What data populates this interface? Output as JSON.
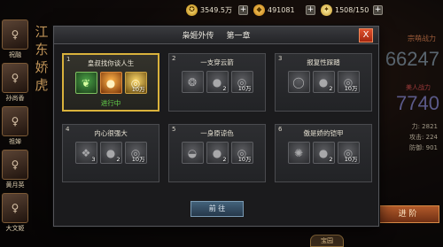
{
  "topbar": {
    "gold": "3549.5万",
    "ingot": "491081",
    "stamina": "1508/150"
  },
  "characters": [
    {
      "name": "祝融"
    },
    {
      "name": "孙尚香"
    },
    {
      "name": "祖婵"
    },
    {
      "name": "黄月英"
    },
    {
      "name": "大文姬"
    }
  ],
  "vertical_title": "江东娇虎",
  "right_panel": {
    "label1": "宗萌战力",
    "power": "66247",
    "label2": "美人战力",
    "power2": "7740",
    "stat_a": "力: 2821",
    "stat_b": "攻击: 224",
    "stat_c": "防御: 901",
    "advance_button": "进 阶",
    "bottom_badge": "宝园"
  },
  "dialog": {
    "title_left": "枭姬外传",
    "title_right": "第一章",
    "close_label": "X",
    "go_button": "前 往",
    "chapters": [
      {
        "num": "1",
        "title": "皇叔找你谈人生",
        "status": "进行中",
        "items": [
          {
            "icon": "green-bamboo-icon",
            "qty": ""
          },
          {
            "icon": "fire-orb-icon",
            "qty": ""
          },
          {
            "icon": "gold-coin-icon",
            "qty": "10万"
          }
        ]
      },
      {
        "num": "2",
        "title": "一支穿云箭",
        "status": "",
        "items": [
          {
            "icon": "gray-bag-icon",
            "qty": ""
          },
          {
            "icon": "gray-orb-icon",
            "qty": "2"
          },
          {
            "icon": "gray-coin-icon",
            "qty": "10万"
          }
        ]
      },
      {
        "num": "3",
        "title": "报复性踩踏",
        "status": "",
        "items": [
          {
            "icon": "gray-ring-icon",
            "qty": ""
          },
          {
            "icon": "gray-orb-icon",
            "qty": "2"
          },
          {
            "icon": "gray-coin-icon",
            "qty": "10万"
          }
        ]
      },
      {
        "num": "4",
        "title": "内心很强大",
        "status": "",
        "items": [
          {
            "icon": "gray-scroll-icon",
            "qty": "3"
          },
          {
            "icon": "gray-orb-icon",
            "qty": "2"
          },
          {
            "icon": "gray-coin-icon",
            "qty": "10万"
          }
        ]
      },
      {
        "num": "5",
        "title": "一身原谅色",
        "status": "",
        "items": [
          {
            "icon": "gray-bowl-icon",
            "qty": ""
          },
          {
            "icon": "gray-orb-icon",
            "qty": "2"
          },
          {
            "icon": "gray-coin-icon",
            "qty": "10万"
          }
        ]
      },
      {
        "num": "6",
        "title": "傲是娇的铠甲",
        "status": "",
        "items": [
          {
            "icon": "gray-flower-icon",
            "qty": ""
          },
          {
            "icon": "gray-orb-icon",
            "qty": "2"
          },
          {
            "icon": "gray-coin-icon",
            "qty": "10万"
          }
        ]
      }
    ]
  }
}
